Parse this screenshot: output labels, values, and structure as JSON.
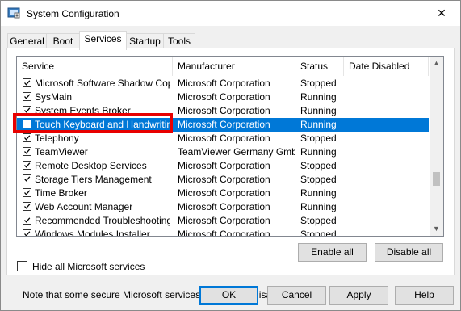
{
  "window": {
    "title": "System Configuration",
    "close_glyph": "✕"
  },
  "tabs": [
    {
      "label": "General",
      "active": false
    },
    {
      "label": "Boot",
      "active": false
    },
    {
      "label": "Services",
      "active": true
    },
    {
      "label": "Startup",
      "active": false
    },
    {
      "label": "Tools",
      "active": false
    }
  ],
  "columns": [
    "Service",
    "Manufacturer",
    "Status",
    "Date Disabled"
  ],
  "rows": [
    {
      "service": "Microsoft Software Shadow Cop...",
      "manufacturer": "Microsoft Corporation",
      "status": "Stopped",
      "checked": true,
      "selected": false
    },
    {
      "service": "SysMain",
      "manufacturer": "Microsoft Corporation",
      "status": "Running",
      "checked": true,
      "selected": false
    },
    {
      "service": "System Events Broker",
      "manufacturer": "Microsoft Corporation",
      "status": "Running",
      "checked": true,
      "selected": false
    },
    {
      "service": "Touch Keyboard and Handwritin...",
      "manufacturer": "Microsoft Corporation",
      "status": "Running",
      "checked": false,
      "selected": true
    },
    {
      "service": "Telephony",
      "manufacturer": "Microsoft Corporation",
      "status": "Stopped",
      "checked": true,
      "selected": false
    },
    {
      "service": "TeamViewer",
      "manufacturer": "TeamViewer Germany GmbH",
      "status": "Running",
      "checked": true,
      "selected": false
    },
    {
      "service": "Remote Desktop Services",
      "manufacturer": "Microsoft Corporation",
      "status": "Stopped",
      "checked": true,
      "selected": false
    },
    {
      "service": "Storage Tiers Management",
      "manufacturer": "Microsoft Corporation",
      "status": "Stopped",
      "checked": true,
      "selected": false
    },
    {
      "service": "Time Broker",
      "manufacturer": "Microsoft Corporation",
      "status": "Running",
      "checked": true,
      "selected": false
    },
    {
      "service": "Web Account Manager",
      "manufacturer": "Microsoft Corporation",
      "status": "Running",
      "checked": true,
      "selected": false
    },
    {
      "service": "Recommended Troubleshooting ...",
      "manufacturer": "Microsoft Corporation",
      "status": "Stopped",
      "checked": true,
      "selected": false
    },
    {
      "service": "Windows Modules Installer",
      "manufacturer": "Microsoft Corporation",
      "status": "Stopped",
      "checked": true,
      "selected": false
    }
  ],
  "note": "Note that some secure Microsoft services may not be disabled.",
  "buttons": {
    "enable_all": "Enable all",
    "disable_all": "Disable all",
    "ok": "OK",
    "cancel": "Cancel",
    "apply": "Apply",
    "help": "Help"
  },
  "hide_ms_label": "Hide all Microsoft services",
  "hide_ms_checked": false,
  "colors": {
    "selection": "#0078d7",
    "highlight_box": "#e80000"
  }
}
